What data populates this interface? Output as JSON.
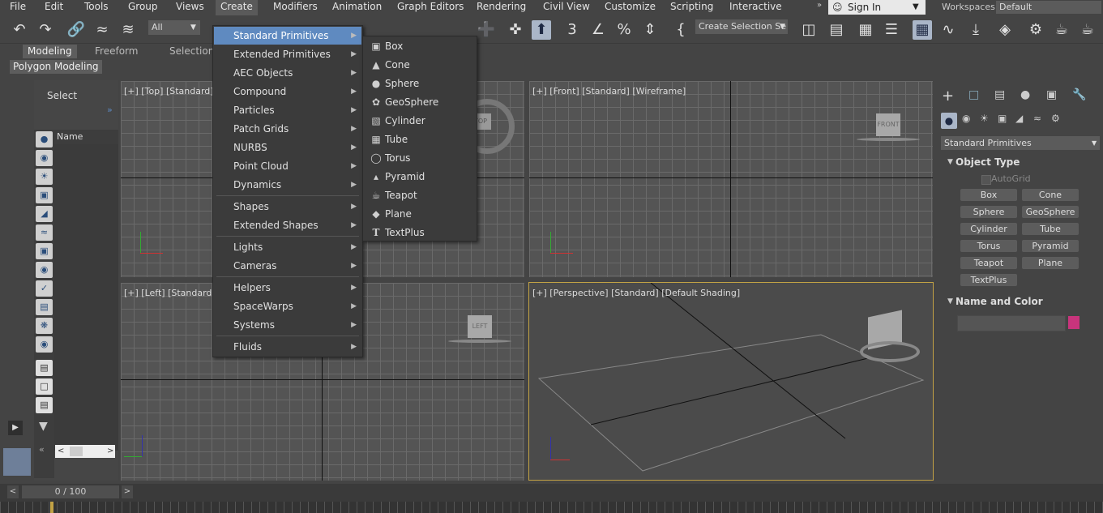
{
  "menubar": {
    "items": [
      "File",
      "Edit",
      "Tools",
      "Group",
      "Views",
      "Create",
      "Modifiers",
      "Animation",
      "Graph Editors",
      "Rendering",
      "Civil View",
      "Customize",
      "Scripting",
      "Interactive"
    ],
    "sign_in": "Sign In",
    "workspaces_label": "Workspaces:",
    "workspaces_value": "Default"
  },
  "toolbar": {
    "filter": "All",
    "selection_set": "Create Selection Se"
  },
  "ribbon": {
    "tabs": [
      "Modeling",
      "Freeform",
      "Selection"
    ],
    "sub": "Polygon Modeling"
  },
  "scene_explorer": {
    "title": "Select",
    "column": "Name (Sorted A"
  },
  "create_menu": {
    "items": [
      "Standard Primitives",
      "Extended Primitives",
      "AEC Objects",
      "Compound",
      "Particles",
      "Patch Grids",
      "NURBS",
      "Point Cloud",
      "Dynamics",
      "Shapes",
      "Extended Shapes",
      "Lights",
      "Cameras",
      "Helpers",
      "SpaceWarps",
      "Systems",
      "Fluids"
    ]
  },
  "submenu": {
    "items": [
      "Box",
      "Cone",
      "Sphere",
      "GeoSphere",
      "Cylinder",
      "Tube",
      "Torus",
      "Pyramid",
      "Teapot",
      "Plane",
      "TextPlus"
    ]
  },
  "viewports": {
    "top": "[+] [Top] [Standard]",
    "front": "[+] [Front] [Standard] [Wireframe]",
    "left": "[+] [Left] [Standard]",
    "perspective": "[+] [Perspective] [Standard] [Default Shading]",
    "front_cube": "FRONT",
    "left_cube": "LEFT",
    "top_cube": "TOP"
  },
  "command_panel": {
    "category": "Standard Primitives",
    "object_type_title": "Object Type",
    "autogrid": "AutoGrid",
    "buttons": [
      "Box",
      "Cone",
      "Sphere",
      "GeoSphere",
      "Cylinder",
      "Tube",
      "Torus",
      "Pyramid",
      "Teapot",
      "Plane",
      "TextPlus"
    ],
    "name_color_title": "Name and Color",
    "color": "#c8347c"
  },
  "timeline": {
    "frame": "0 / 100"
  }
}
